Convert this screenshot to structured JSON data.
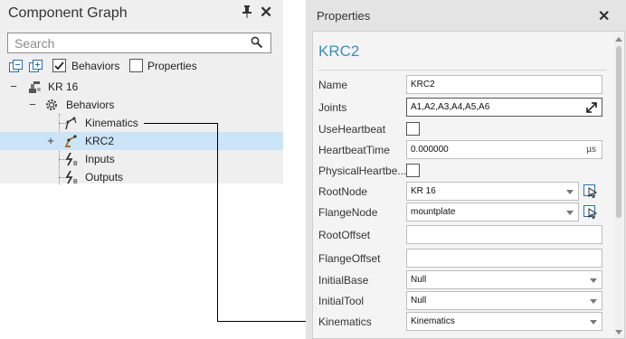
{
  "component_graph": {
    "title": "Component Graph",
    "pin_icon": "pin-icon",
    "close_icon": "close-icon",
    "search_placeholder": "Search",
    "filter_behaviors": {
      "label": "Behaviors",
      "checked": true
    },
    "filter_properties": {
      "label": "Properties",
      "checked": false
    },
    "tree": [
      {
        "label": "KR 16",
        "expander": "−",
        "icon": "robot-icon"
      },
      {
        "label": "Behaviors",
        "expander": "−",
        "icon": "gear-icon"
      },
      {
        "label": "Kinematics",
        "expander": "",
        "icon": "kinematics-icon"
      },
      {
        "label": "KRC2",
        "expander": "+",
        "icon": "robot-controller-icon",
        "selected": true
      },
      {
        "label": "Inputs",
        "expander": "",
        "icon": "signal-input-icon"
      },
      {
        "label": "Outputs",
        "expander": "",
        "icon": "signal-output-icon"
      }
    ]
  },
  "properties": {
    "title": "Properties",
    "component_name": "KRC2",
    "rows": [
      {
        "label": "Name",
        "value": "KRC2"
      },
      {
        "label": "Joints",
        "value": "A1,A2,A3,A4,A5,A6"
      },
      {
        "label": "UseHeartbeat",
        "checked": false
      },
      {
        "label": "HeartbeatTime",
        "value": "0.000000",
        "unit": "µs"
      },
      {
        "label": "PhysicalHeartbe...",
        "checked": false
      },
      {
        "label": "RootNode",
        "value": "KR 16"
      },
      {
        "label": "FlangeNode",
        "value": "mountplate"
      },
      {
        "label": "RootOffset",
        "value": ""
      },
      {
        "label": "FlangeOffset",
        "value": ""
      },
      {
        "label": "InitialBase",
        "value": "Null"
      },
      {
        "label": "InitialTool",
        "value": "Null"
      },
      {
        "label": "Kinematics",
        "value": "Kinematics"
      }
    ]
  },
  "colors": {
    "accent": "#3d8fc0",
    "selection": "#cce4f7"
  }
}
